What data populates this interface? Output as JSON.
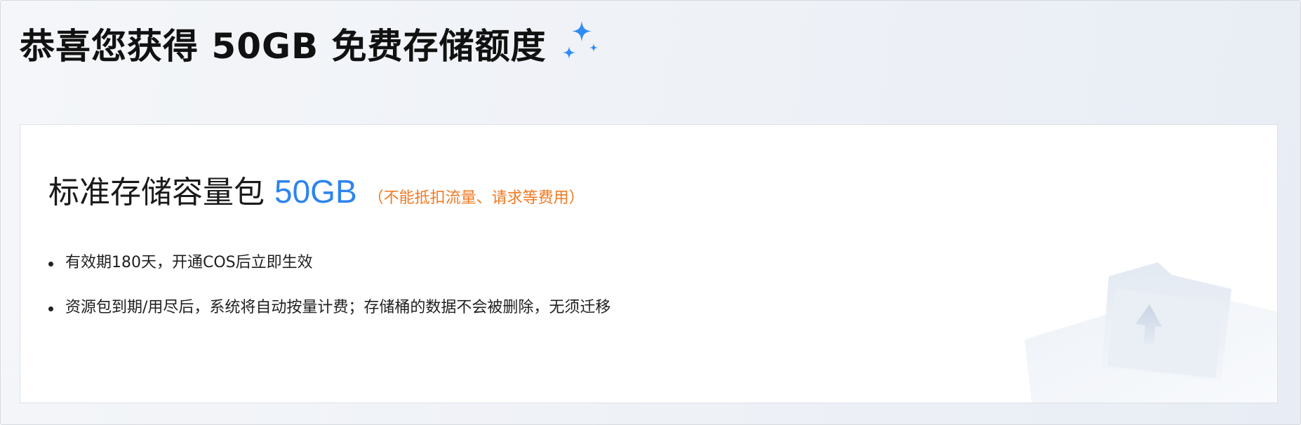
{
  "header": {
    "title": "恭喜您获得 50GB 免费存储额度",
    "title_icon": "sparkle-icon"
  },
  "package": {
    "name": "标准存储容量包",
    "size": "50GB",
    "note": "（不能抵扣流量、请求等费用）",
    "features": [
      "有效期180天，开通COS后立即生效",
      "资源包到期/用尽后，系统将自动按量计费；存储桶的数据不会被删除，无须迁移"
    ]
  },
  "illustration_icon": "folder-upload-icon",
  "colors": {
    "accent_blue": "#2d84ee",
    "note_orange": "#f07a22",
    "sparkle_blue": "#2f8cf5"
  }
}
